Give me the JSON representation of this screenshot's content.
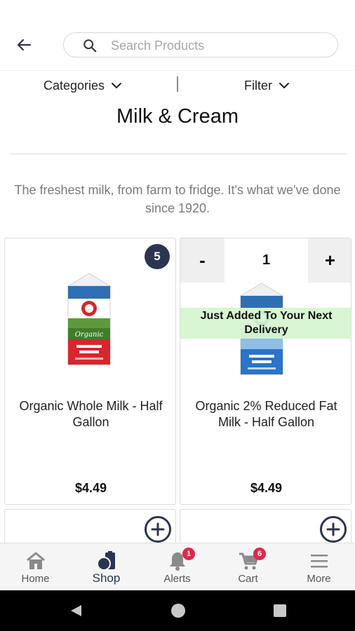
{
  "search": {
    "placeholder": "Search Products"
  },
  "filterbar": {
    "categories_label": "Categories",
    "filter_label": "Filter"
  },
  "page": {
    "title": "Milk & Cream",
    "tagline": "The freshest milk, from farm to fridge. It's what we've done since 1920."
  },
  "products": [
    {
      "name": "Organic Whole Milk - Half Gallon",
      "price": "$4.49",
      "count_badge": "5"
    },
    {
      "name": "Organic 2% Reduced Fat Milk - Half Gallon",
      "price": "$4.49",
      "quantity": "1",
      "minus": "-",
      "plus": "+",
      "added_banner": "Just Added To Your Next Delivery"
    }
  ],
  "bottom_nav": [
    {
      "label": "Home",
      "icon": "home-icon"
    },
    {
      "label": "Shop",
      "icon": "shop-icon",
      "active": true
    },
    {
      "label": "Alerts",
      "icon": "bell-icon",
      "badge": "1"
    },
    {
      "label": "Cart",
      "icon": "cart-icon",
      "badge": "6"
    },
    {
      "label": "More",
      "icon": "menu-icon"
    }
  ],
  "colors": {
    "accent": "#2b3551",
    "badge": "#e0284a",
    "added_banner_bg": "#d5f5cd"
  }
}
